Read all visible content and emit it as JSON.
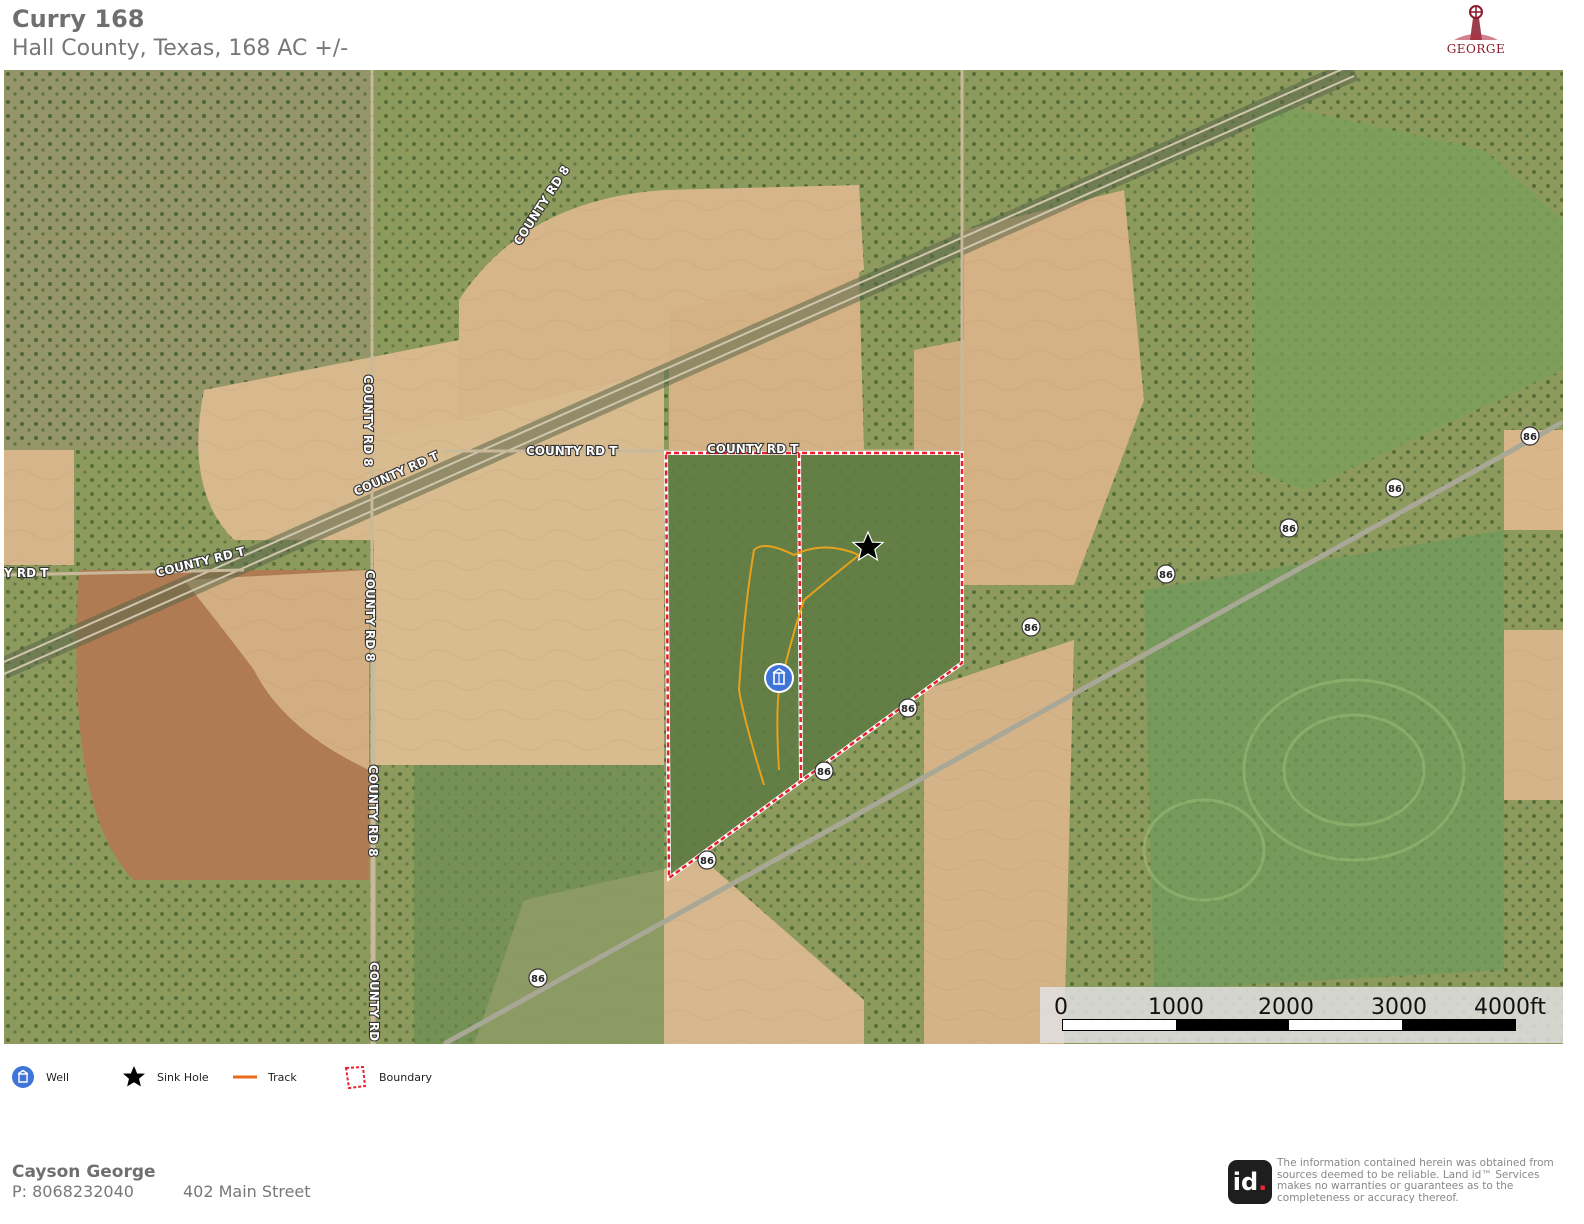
{
  "header": {
    "title": "Curry 168",
    "subtitle": "Hall County, Texas, 168 AC +/-",
    "logo_text": "GEORGE"
  },
  "map": {
    "road_labels": {
      "county_rd_8_north": "COUNTY RD 8",
      "county_rd_8_mid": "COUNTY RD 8",
      "county_rd_8_south_a": "COUNTY RD 8",
      "county_rd_8_south_b": "COUNTY RD 8",
      "county_rd_8_bottom": "COUNTY RD",
      "county_rd_t_a": "COUNTY RD T",
      "county_rd_t_b": "COUNTY RD T",
      "county_rd_t_c": "COUNTY RD T",
      "county_rd_t_d": "COUNTY RD T",
      "county_rd_t_edge": "Y RD T"
    },
    "highway_shield": "86",
    "colors": {
      "boundary": "#e8202e",
      "track": "#e8a21a",
      "well": "#3f74d8",
      "sinkhole": "#000000"
    }
  },
  "scale": {
    "labels": [
      "0",
      "1000",
      "2000",
      "3000",
      "4000ft"
    ]
  },
  "legend": {
    "well": "Well",
    "sink_hole": "Sink Hole",
    "track": "Track",
    "boundary": "Boundary"
  },
  "footer": {
    "agent_name": "Cayson George",
    "agent_phone": "P: 8068232040",
    "agent_address": "402 Main Street",
    "id_logo": "id",
    "id_logo_dot": ".",
    "disclaimer": "The information contained herein was obtained from sources deemed to be reliable. Land id™ Services makes no warranties or guarantees as to the completeness or accuracy thereof."
  }
}
